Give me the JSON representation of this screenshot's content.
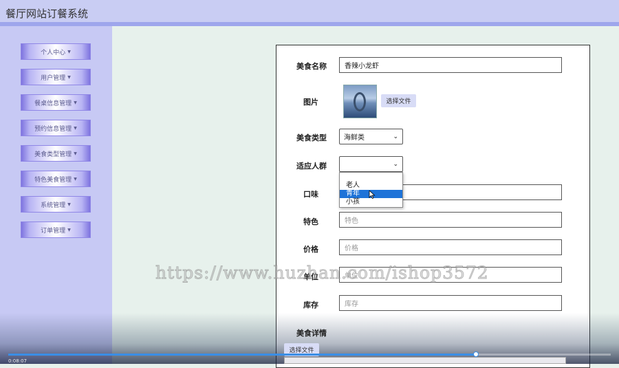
{
  "app": {
    "title": "餐厅网站订餐系统"
  },
  "sidebar": {
    "items": [
      {
        "label": "个人中心"
      },
      {
        "label": "用户管理"
      },
      {
        "label": "餐桌信息管理"
      },
      {
        "label": "预约信息管理"
      },
      {
        "label": "美食类型管理"
      },
      {
        "label": "特色美食管理"
      },
      {
        "label": "系统管理"
      },
      {
        "label": "订单管理"
      }
    ],
    "caret": "▼"
  },
  "form": {
    "name": {
      "label": "美食名称",
      "value": "香辣小龙虾"
    },
    "image": {
      "label": "图片",
      "button": "选择文件"
    },
    "type": {
      "label": "美食类型",
      "value": "海鲜类"
    },
    "audience": {
      "label": "适应人群",
      "value": "",
      "options": [
        "老人",
        "青年",
        "小孩"
      ],
      "highlighted": "青年"
    },
    "taste": {
      "label": "口味",
      "placeholder": ""
    },
    "feature": {
      "label": "特色",
      "placeholder": "特色"
    },
    "price": {
      "label": "价格",
      "placeholder": "价格"
    },
    "unit": {
      "label": "单位",
      "placeholder": "单位"
    },
    "stock": {
      "label": "库存",
      "placeholder": "库存"
    },
    "detail": {
      "label": "美食详情",
      "upload_button": "选择文件"
    }
  },
  "watermark": "https://www.huzhan.com/ishop3572",
  "video": {
    "time": "0:08:07",
    "progress": 0.776
  },
  "colors": {
    "sidebar_bg": "#c7c9f4",
    "topbar_bg": "#c9cdf3",
    "content_bg": "#e7f1ec",
    "selected_option": "#1e73d8"
  }
}
